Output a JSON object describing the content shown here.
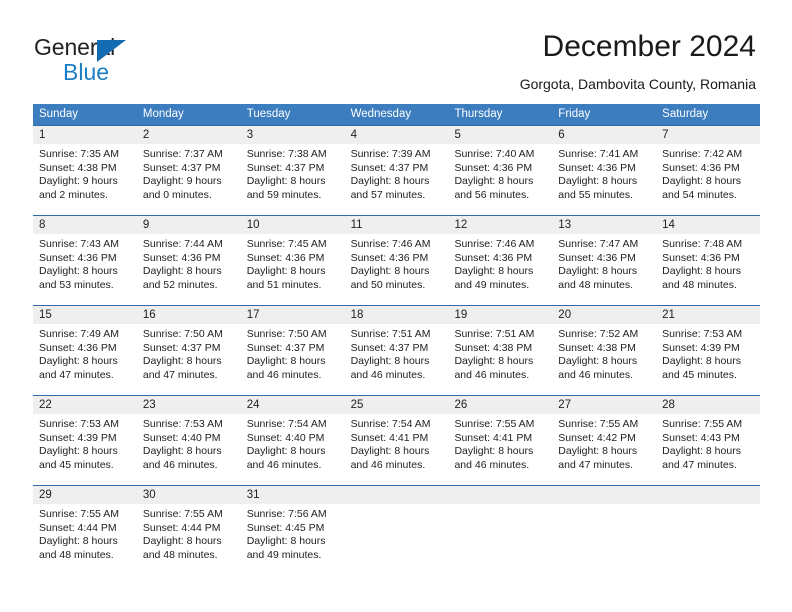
{
  "brand": {
    "name_top": "General",
    "name_bottom": "Blue",
    "accent_color": "#1b7ec4",
    "triangle_color": "#136bb2"
  },
  "header": {
    "title": "December 2024",
    "subtitle": "Gorgota, Dambovita County, Romania",
    "header_bg": "#3b7dbf",
    "row_divider": "#2f6ba6",
    "daynum_bg": "#efeff0"
  },
  "weekdays": [
    "Sunday",
    "Monday",
    "Tuesday",
    "Wednesday",
    "Thursday",
    "Friday",
    "Saturday"
  ],
  "weeks": [
    [
      {
        "day": "1",
        "sunrise": "Sunrise: 7:35 AM",
        "sunset": "Sunset: 4:38 PM",
        "daylight1": "Daylight: 9 hours",
        "daylight2": "and 2 minutes."
      },
      {
        "day": "2",
        "sunrise": "Sunrise: 7:37 AM",
        "sunset": "Sunset: 4:37 PM",
        "daylight1": "Daylight: 9 hours",
        "daylight2": "and 0 minutes."
      },
      {
        "day": "3",
        "sunrise": "Sunrise: 7:38 AM",
        "sunset": "Sunset: 4:37 PM",
        "daylight1": "Daylight: 8 hours",
        "daylight2": "and 59 minutes."
      },
      {
        "day": "4",
        "sunrise": "Sunrise: 7:39 AM",
        "sunset": "Sunset: 4:37 PM",
        "daylight1": "Daylight: 8 hours",
        "daylight2": "and 57 minutes."
      },
      {
        "day": "5",
        "sunrise": "Sunrise: 7:40 AM",
        "sunset": "Sunset: 4:36 PM",
        "daylight1": "Daylight: 8 hours",
        "daylight2": "and 56 minutes."
      },
      {
        "day": "6",
        "sunrise": "Sunrise: 7:41 AM",
        "sunset": "Sunset: 4:36 PM",
        "daylight1": "Daylight: 8 hours",
        "daylight2": "and 55 minutes."
      },
      {
        "day": "7",
        "sunrise": "Sunrise: 7:42 AM",
        "sunset": "Sunset: 4:36 PM",
        "daylight1": "Daylight: 8 hours",
        "daylight2": "and 54 minutes."
      }
    ],
    [
      {
        "day": "8",
        "sunrise": "Sunrise: 7:43 AM",
        "sunset": "Sunset: 4:36 PM",
        "daylight1": "Daylight: 8 hours",
        "daylight2": "and 53 minutes."
      },
      {
        "day": "9",
        "sunrise": "Sunrise: 7:44 AM",
        "sunset": "Sunset: 4:36 PM",
        "daylight1": "Daylight: 8 hours",
        "daylight2": "and 52 minutes."
      },
      {
        "day": "10",
        "sunrise": "Sunrise: 7:45 AM",
        "sunset": "Sunset: 4:36 PM",
        "daylight1": "Daylight: 8 hours",
        "daylight2": "and 51 minutes."
      },
      {
        "day": "11",
        "sunrise": "Sunrise: 7:46 AM",
        "sunset": "Sunset: 4:36 PM",
        "daylight1": "Daylight: 8 hours",
        "daylight2": "and 50 minutes."
      },
      {
        "day": "12",
        "sunrise": "Sunrise: 7:46 AM",
        "sunset": "Sunset: 4:36 PM",
        "daylight1": "Daylight: 8 hours",
        "daylight2": "and 49 minutes."
      },
      {
        "day": "13",
        "sunrise": "Sunrise: 7:47 AM",
        "sunset": "Sunset: 4:36 PM",
        "daylight1": "Daylight: 8 hours",
        "daylight2": "and 48 minutes."
      },
      {
        "day": "14",
        "sunrise": "Sunrise: 7:48 AM",
        "sunset": "Sunset: 4:36 PM",
        "daylight1": "Daylight: 8 hours",
        "daylight2": "and 48 minutes."
      }
    ],
    [
      {
        "day": "15",
        "sunrise": "Sunrise: 7:49 AM",
        "sunset": "Sunset: 4:36 PM",
        "daylight1": "Daylight: 8 hours",
        "daylight2": "and 47 minutes."
      },
      {
        "day": "16",
        "sunrise": "Sunrise: 7:50 AM",
        "sunset": "Sunset: 4:37 PM",
        "daylight1": "Daylight: 8 hours",
        "daylight2": "and 47 minutes."
      },
      {
        "day": "17",
        "sunrise": "Sunrise: 7:50 AM",
        "sunset": "Sunset: 4:37 PM",
        "daylight1": "Daylight: 8 hours",
        "daylight2": "and 46 minutes."
      },
      {
        "day": "18",
        "sunrise": "Sunrise: 7:51 AM",
        "sunset": "Sunset: 4:37 PM",
        "daylight1": "Daylight: 8 hours",
        "daylight2": "and 46 minutes."
      },
      {
        "day": "19",
        "sunrise": "Sunrise: 7:51 AM",
        "sunset": "Sunset: 4:38 PM",
        "daylight1": "Daylight: 8 hours",
        "daylight2": "and 46 minutes."
      },
      {
        "day": "20",
        "sunrise": "Sunrise: 7:52 AM",
        "sunset": "Sunset: 4:38 PM",
        "daylight1": "Daylight: 8 hours",
        "daylight2": "and 46 minutes."
      },
      {
        "day": "21",
        "sunrise": "Sunrise: 7:53 AM",
        "sunset": "Sunset: 4:39 PM",
        "daylight1": "Daylight: 8 hours",
        "daylight2": "and 45 minutes."
      }
    ],
    [
      {
        "day": "22",
        "sunrise": "Sunrise: 7:53 AM",
        "sunset": "Sunset: 4:39 PM",
        "daylight1": "Daylight: 8 hours",
        "daylight2": "and 45 minutes."
      },
      {
        "day": "23",
        "sunrise": "Sunrise: 7:53 AM",
        "sunset": "Sunset: 4:40 PM",
        "daylight1": "Daylight: 8 hours",
        "daylight2": "and 46 minutes."
      },
      {
        "day": "24",
        "sunrise": "Sunrise: 7:54 AM",
        "sunset": "Sunset: 4:40 PM",
        "daylight1": "Daylight: 8 hours",
        "daylight2": "and 46 minutes."
      },
      {
        "day": "25",
        "sunrise": "Sunrise: 7:54 AM",
        "sunset": "Sunset: 4:41 PM",
        "daylight1": "Daylight: 8 hours",
        "daylight2": "and 46 minutes."
      },
      {
        "day": "26",
        "sunrise": "Sunrise: 7:55 AM",
        "sunset": "Sunset: 4:41 PM",
        "daylight1": "Daylight: 8 hours",
        "daylight2": "and 46 minutes."
      },
      {
        "day": "27",
        "sunrise": "Sunrise: 7:55 AM",
        "sunset": "Sunset: 4:42 PM",
        "daylight1": "Daylight: 8 hours",
        "daylight2": "and 47 minutes."
      },
      {
        "day": "28",
        "sunrise": "Sunrise: 7:55 AM",
        "sunset": "Sunset: 4:43 PM",
        "daylight1": "Daylight: 8 hours",
        "daylight2": "and 47 minutes."
      }
    ],
    [
      {
        "day": "29",
        "sunrise": "Sunrise: 7:55 AM",
        "sunset": "Sunset: 4:44 PM",
        "daylight1": "Daylight: 8 hours",
        "daylight2": "and 48 minutes."
      },
      {
        "day": "30",
        "sunrise": "Sunrise: 7:55 AM",
        "sunset": "Sunset: 4:44 PM",
        "daylight1": "Daylight: 8 hours",
        "daylight2": "and 48 minutes."
      },
      {
        "day": "31",
        "sunrise": "Sunrise: 7:56 AM",
        "sunset": "Sunset: 4:45 PM",
        "daylight1": "Daylight: 8 hours",
        "daylight2": "and 49 minutes."
      },
      {
        "day": "",
        "sunrise": "",
        "sunset": "",
        "daylight1": "",
        "daylight2": ""
      },
      {
        "day": "",
        "sunrise": "",
        "sunset": "",
        "daylight1": "",
        "daylight2": ""
      },
      {
        "day": "",
        "sunrise": "",
        "sunset": "",
        "daylight1": "",
        "daylight2": ""
      },
      {
        "day": "",
        "sunrise": "",
        "sunset": "",
        "daylight1": "",
        "daylight2": ""
      }
    ]
  ]
}
